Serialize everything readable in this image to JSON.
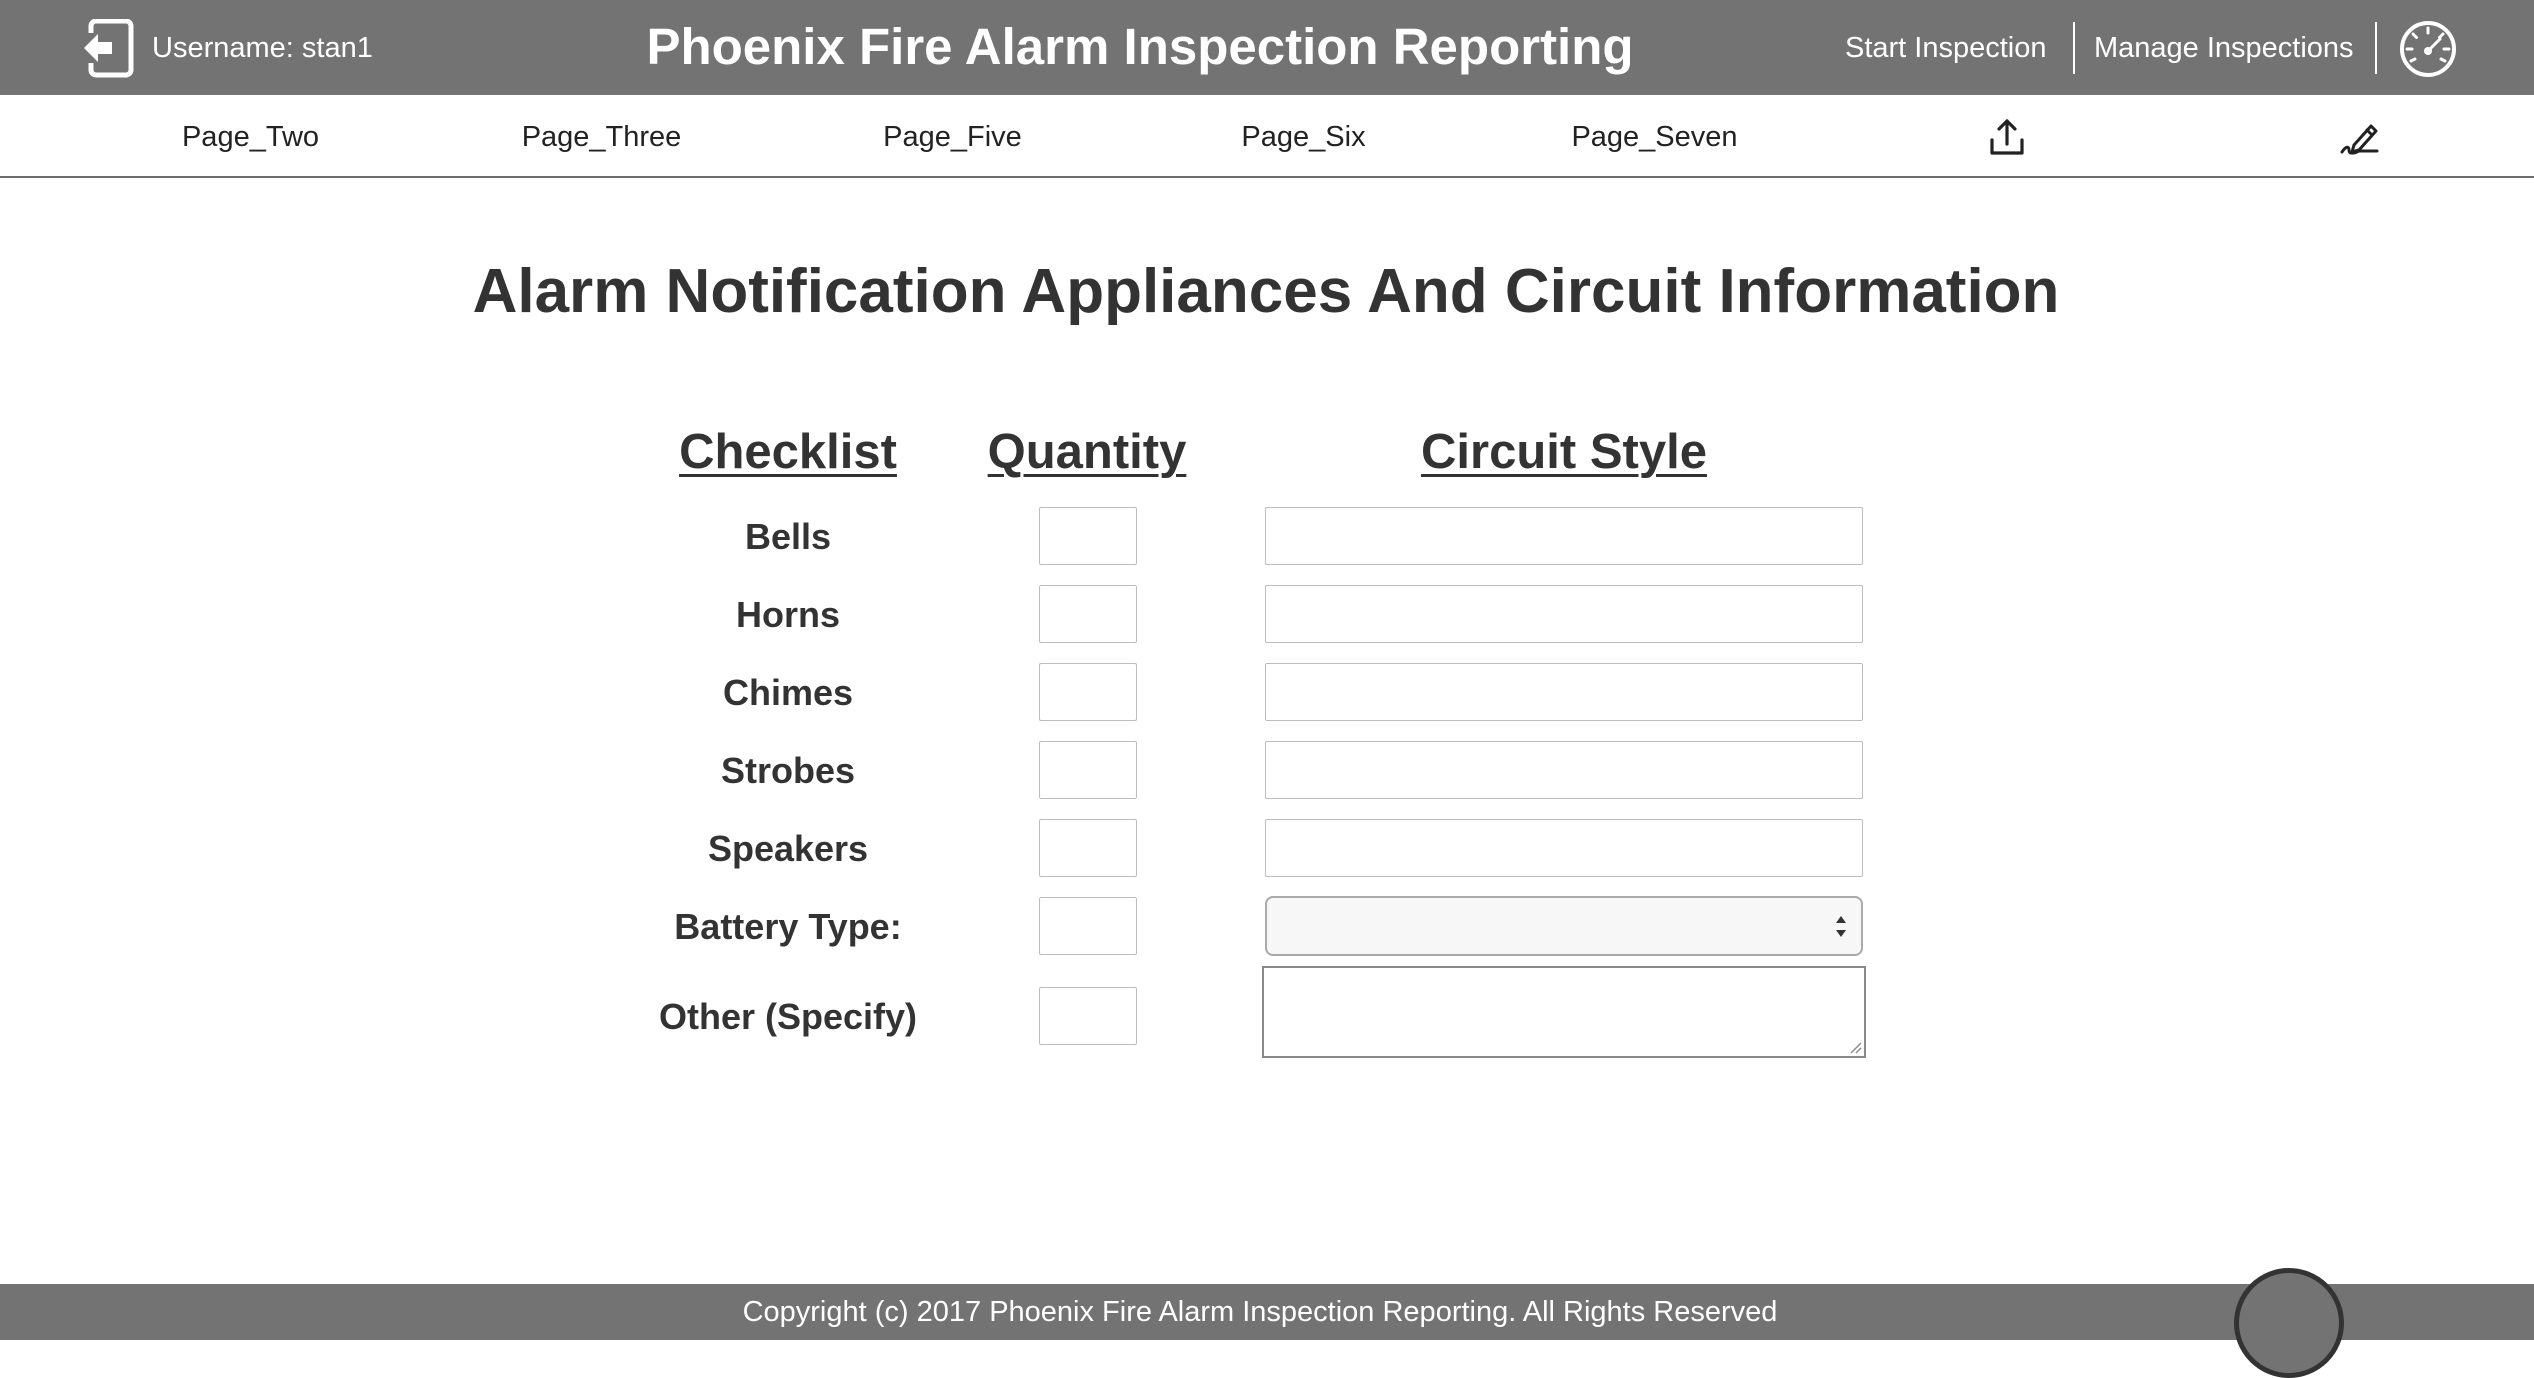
{
  "header": {
    "username_label": "Username: stan1",
    "title": "Phoenix Fire Alarm Inspection Reporting",
    "nav": [
      {
        "label": "Start Inspection"
      },
      {
        "label": "Manage Inspections"
      }
    ],
    "icons": {
      "logout": "logout-icon",
      "dashboard": "dashboard-gauge-icon"
    }
  },
  "subnav": {
    "items": [
      {
        "label": "Page_Two"
      },
      {
        "label": "Page_Three"
      },
      {
        "label": "Page_Five"
      },
      {
        "label": "Page_Six"
      },
      {
        "label": "Page_Seven"
      }
    ],
    "icons": {
      "upload": "upload-icon",
      "sign": "signature-pen-icon"
    }
  },
  "main": {
    "heading": "Alarm Notification Appliances And Circuit Information",
    "columns": {
      "checklist": "Checklist",
      "quantity": "Quantity",
      "circuit_style": "Circuit Style"
    },
    "rows": [
      {
        "label": "Bells",
        "quantity": "",
        "circuit_style": ""
      },
      {
        "label": "Horns",
        "quantity": "",
        "circuit_style": ""
      },
      {
        "label": "Chimes",
        "quantity": "",
        "circuit_style": ""
      },
      {
        "label": "Strobes",
        "quantity": "",
        "circuit_style": ""
      },
      {
        "label": "Speakers",
        "quantity": "",
        "circuit_style": ""
      },
      {
        "label": "Battery Type:",
        "quantity": "",
        "circuit_style": ""
      },
      {
        "label": "Other (Specify)",
        "quantity": "",
        "circuit_style": ""
      }
    ]
  },
  "footer": {
    "text": "Copyright (c) 2017 Phoenix Fire Alarm Inspection Reporting. All Rights Reserved"
  },
  "colors": {
    "header_bg": "#737373",
    "text": "#333333",
    "border": "#bdbdbd"
  }
}
